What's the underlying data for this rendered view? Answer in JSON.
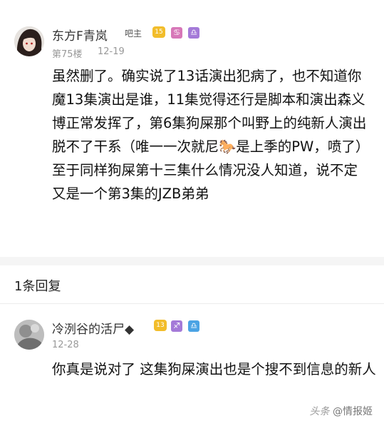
{
  "post": {
    "author": "东方F青岚",
    "role": "吧主",
    "level": "15",
    "floor": "第75楼",
    "date": "12-19",
    "text": "虽然删了。确实说了13话演出犯病了，也不知道你魔13集演出是谁，11集觉得还行是脚本和演出森义博正常发挥了，第6集狗屎那个叫野上的纯新人演出脱不了干系（唯一一次就尼🐎是上季的PW，喷了）至于同样狗屎第十三集什么情况没人知道，说不定又是一个第3集的JZB弟弟"
  },
  "reply_count": "1条回复",
  "reply": {
    "author": "冷洌谷的活尸◆",
    "level": "13",
    "date": "12-28",
    "text": "你真是说对了 这集狗屎演出也是个搜不到信息的新人"
  },
  "watermark": {
    "logo": "头条",
    "handle": "@情报姬"
  },
  "colors": {
    "level_badge": "#f2bd2b",
    "zodiac_main": "#d777b8",
    "zodiac_alt": "#a47ad8",
    "zodiac_reply": "#4ba3e4"
  },
  "icons": {
    "main_zodiac_1": "cancer-icon",
    "main_zodiac_2": "libra-icon",
    "reply_zodiac_1": "sagittarius-icon",
    "reply_zodiac_2": "libra-icon"
  }
}
